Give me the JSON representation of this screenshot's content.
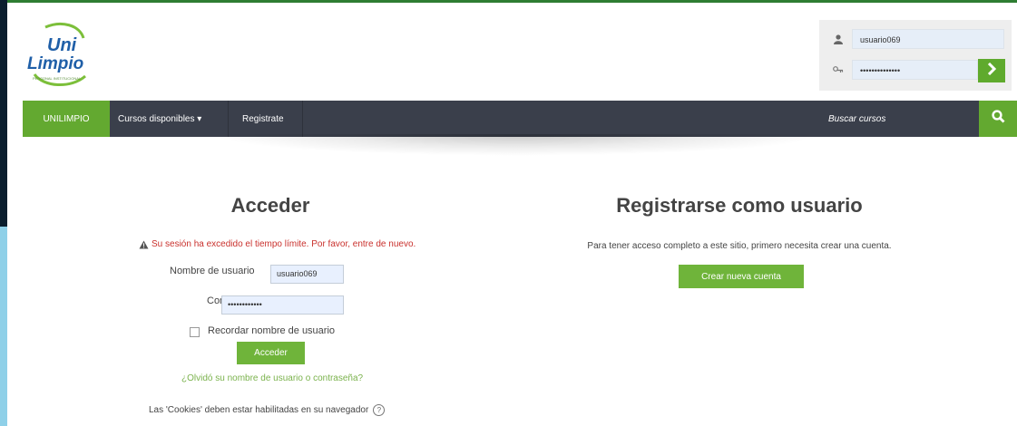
{
  "brand": {
    "logo_line1": "Uni",
    "logo_line2": "Limpio",
    "logo_tagline": "PERSONAL INSTITUCIONAL"
  },
  "login_box": {
    "username_value": "usuario069",
    "password_value": "••••••••••••••",
    "go_icon": "chevron-right-icon"
  },
  "navbar": {
    "home": "UNILIMPIO",
    "courses": "Cursos disponibles ▾",
    "register": "Registrate",
    "search_placeholder": "Buscar cursos",
    "search_icon": "search-icon"
  },
  "login": {
    "title": "Acceder",
    "warning": "Su sesión ha excedido el tiempo límite. Por favor, entre de nuevo.",
    "username_label": "Nombre de usuario",
    "username_value": "usuario069",
    "password_label": "Contraseña",
    "password_value": "••••••••••••",
    "remember_label": "Recordar nombre de usuario",
    "submit": "Acceder",
    "forgot": "¿Olvidó su nombre de usuario o contraseña?",
    "cookies": "Las 'Cookies' deben estar habilitadas en su navegador",
    "help": "?"
  },
  "register": {
    "title": "Registrarse como usuario",
    "text": "Para tener acceso completo a este sitio, primero necesita crear una cuenta.",
    "button": "Crear nueva cuenta"
  },
  "colors": {
    "accent_green": "#63a930",
    "nav_dark": "#3a3f4b",
    "error_red": "#c9302c"
  }
}
